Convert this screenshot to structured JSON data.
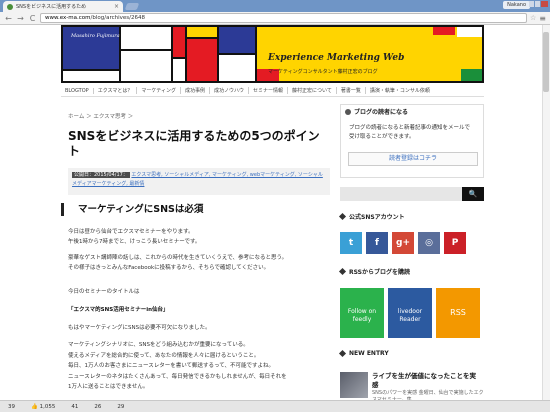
{
  "browser": {
    "tab_title": "SNSをビジネスに活用するため",
    "tab_close": "×",
    "profile": "Nakano",
    "url_prefix": "www.ex-ma.com",
    "url_path": "/blog/archives/2648",
    "nav_back": "←",
    "nav_forward": "→",
    "nav_reload": "C",
    "star": "☆",
    "menu": "≡"
  },
  "header": {
    "title": "Experience Marketing Web",
    "subtitle": "マーケティングコンサルタント藤村正宏のブログ",
    "signature": "Masahiro Fujimura",
    "colors": [
      "#ffd400",
      "#e41b23",
      "#2c3a96",
      "#ffffff",
      "#1a8f3a",
      "#111111"
    ]
  },
  "nav": {
    "items": [
      "BLOGTOP",
      "エクスマとは？",
      "マーケティング",
      "成功事例",
      "成功ノウハウ",
      "セミナー情報",
      "藤村正宏について",
      "著書一覧",
      "講演・執筆・コンサル依頼"
    ]
  },
  "article": {
    "breadcrumb": "ホーム ＞ エクスマ思考 ＞",
    "title": "SNSをビジネスに活用するための5つのポイント",
    "date": "公開日：2015/04/17：",
    "tags": "エクスマ思考, ソーシャルメディア, マーケティング, webマーケティング, ソーシャルメディアマーケティング, 最新情",
    "heading": "マーケティングにSNSは必須",
    "p1": "今日は昼から仙台でエクスマセミナーをやります。",
    "p1b": "午後1時から7時までと、けっこう長いセミナーです。",
    "p2": "豪華なゲスト講師陣の話しは、これからの時代を生きていくうえで、参考になると思う。",
    "p2b": "その様子はきっとみんなFacebookに投稿するから、そちらで確認してください。",
    "p3": "今日のセミナーのタイトルは",
    "p4": "「エクスマ的SNS活用セミナーin仙台」",
    "p5": "もはやマーケティングにSNSは必要不可欠になりました。",
    "p6a": "マーケティングシナリオに、SNSをどう組み込むかが重要になっている。",
    "p6b": "使えるメディアを総合的に使って、あなたの情報を人々に届けるということ。",
    "p6c": "毎日、1万人のお客さまにニュースレターを書いて郵送するって、不可能ですよね。",
    "p6d": "ニュースレターのネタはたくさんあって、毎日発信できるかもしれませんが、毎日それを",
    "p6e": "1万人に送ることはできません。"
  },
  "sidebar": {
    "reader_title": "ブログの読者になる",
    "reader_text": "ブログの読者になると新着記事の通知をメールで受け取ることができます。",
    "reader_button": "読者登録はコチラ",
    "search_icon": "🔍",
    "sns_title": "公式SNSアカウント",
    "social": [
      {
        "label": "t",
        "color": "#3aa0d6"
      },
      {
        "label": "f",
        "color": "#365899"
      },
      {
        "label": "g+",
        "color": "#d34836"
      },
      {
        "label": "◎",
        "color": "#5a6e9a"
      },
      {
        "label": "P",
        "color": "#cb2027"
      }
    ],
    "rss_title": "RSSからブログを購読",
    "feeds": [
      {
        "label": "Follow on feedly",
        "color": "#2bb24c"
      },
      {
        "label": "livedoor Reader",
        "color": "#2c5aa0"
      },
      {
        "label": "RSS",
        "color": "#f39800"
      }
    ],
    "new_title": "NEW ENTRY",
    "new_item_title": "ライブを生が価値になったことを実感",
    "new_item_sub": "SNSのパワーを実感 金曜日、仙台で実施したエクスマセミナー。集"
  },
  "share": {
    "items": [
      "39",
      "👍 1,055",
      "41",
      "26",
      "29"
    ]
  }
}
